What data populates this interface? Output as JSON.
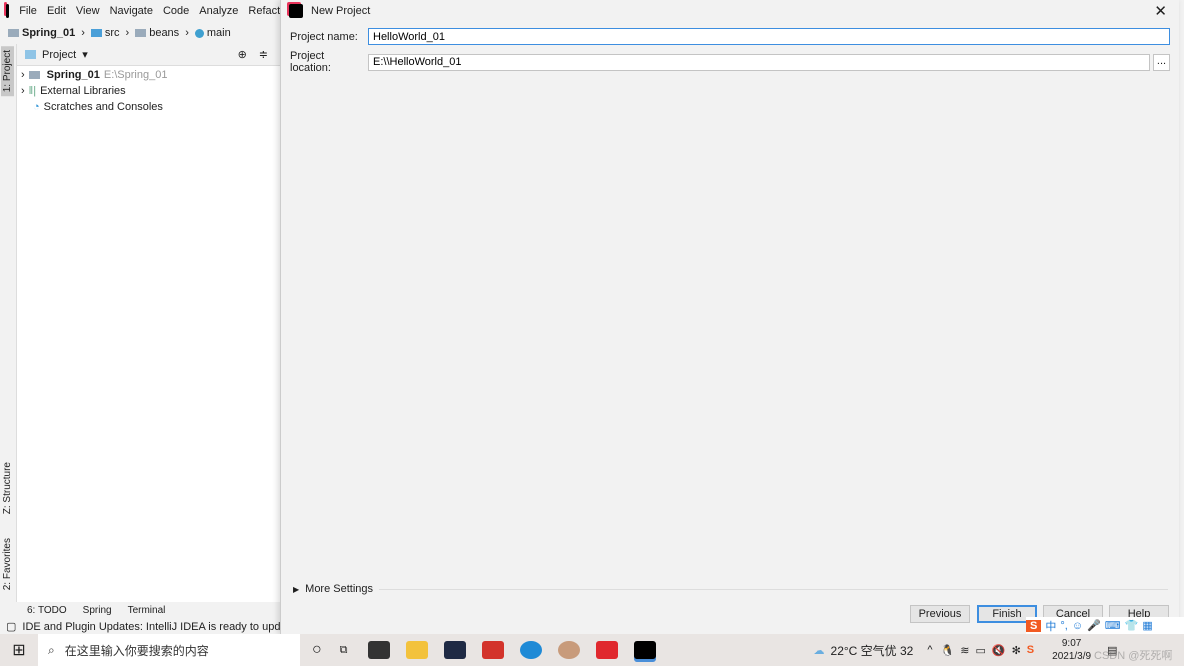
{
  "ide": {
    "menu": [
      "File",
      "Edit",
      "View",
      "Navigate",
      "Code",
      "Analyze",
      "Refactor"
    ],
    "breadcrumbs": [
      "Spring_01",
      "src",
      "beans",
      "main"
    ],
    "left_tabs": [
      "1: Project",
      "Z: Structure",
      "2: Favorites"
    ],
    "project_panel": {
      "title": "Project",
      "tree": [
        {
          "label": "Spring_01",
          "path": "E:\\Spring_01"
        },
        {
          "label": "External Libraries"
        },
        {
          "label": "Scratches and Consoles"
        }
      ]
    },
    "bottom_tabs": [
      "6: TODO",
      "Spring",
      "Terminal"
    ],
    "status": "IDE and Plugin Updates: IntelliJ IDEA is ready to update. (m"
  },
  "dialog": {
    "title": "New Project",
    "project_name_label": "Project name:",
    "project_name": "HelloWorld_01",
    "project_location_label": "Project location:",
    "project_location": "E:\\\\HelloWorld_01",
    "browse": "...",
    "more_settings": "More Settings",
    "buttons": {
      "previous": "Previous",
      "finish": "Finish",
      "cancel": "Cancel",
      "help": "Help"
    }
  },
  "taskbar": {
    "search_placeholder": "在这里输入你要搜索的内容",
    "weather": "22°C 空气优 32",
    "time": "9:07",
    "date": "2021/3/9",
    "ime": "中",
    "watermark": "CSDN @死死啊"
  }
}
